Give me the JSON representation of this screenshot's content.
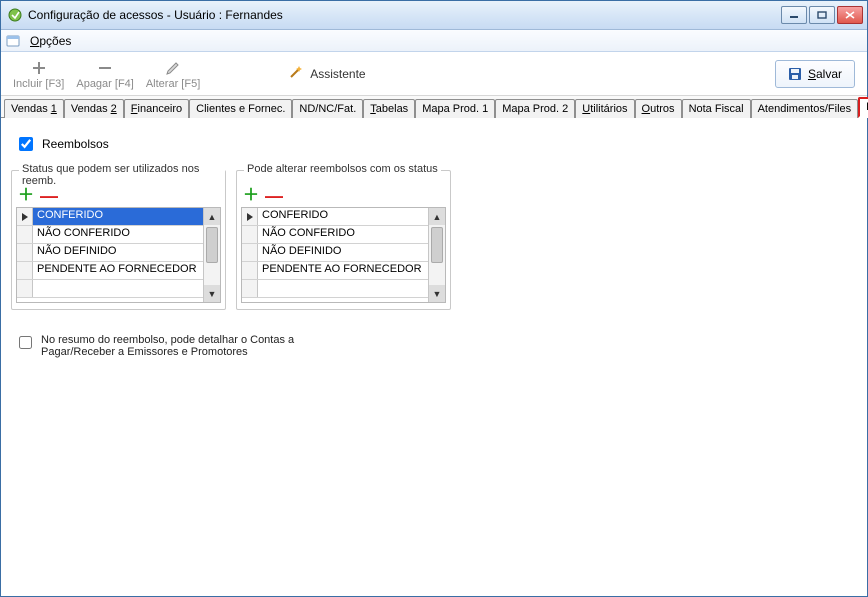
{
  "title": "Configuração de acessos - Usuário : Fernandes",
  "menu": {
    "options": "Opções",
    "options_u": "O"
  },
  "toolbar": {
    "include": "Incluir [F3]",
    "delete": "Apagar [F4]",
    "alter": "Alterar [F5]",
    "assistant": "Assistente",
    "save": "Salvar",
    "save_u": "S"
  },
  "tabs": {
    "t1": "Vendas 1",
    "t1u": "1",
    "t2": "Vendas 2",
    "t2u": "2",
    "t3": "Financeiro",
    "t3u": "F",
    "t4": "Clientes e Fornec.",
    "t5": "ND/NC/Fat.",
    "t6": "Tabelas",
    "t6u": "T",
    "t7": "Mapa Prod. 1",
    "t8": "Mapa Prod. 2",
    "t9": "Utilitários",
    "t9u": "U",
    "t10": "Outros",
    "t10u": "O",
    "t11": "Nota Fiscal",
    "t12": "Atendimentos/Files",
    "t13": "Reemb."
  },
  "reemb": {
    "checkbox_label": "Reembolsos",
    "panel1_caption": "Status que podem ser utilizados nos reemb.",
    "panel2_caption": "Pode alterar reembolsos com os status",
    "rows": {
      "r1": "CONFERIDO",
      "r2": "NÃO CONFERIDO",
      "r3": "NÃO DEFINIDO",
      "r4": "PENDENTE AO FORNECEDOR"
    },
    "detail_checkbox": "No resumo do reembolso, pode detalhar o Contas a Pagar/Receber a Emissores e Promotores"
  }
}
